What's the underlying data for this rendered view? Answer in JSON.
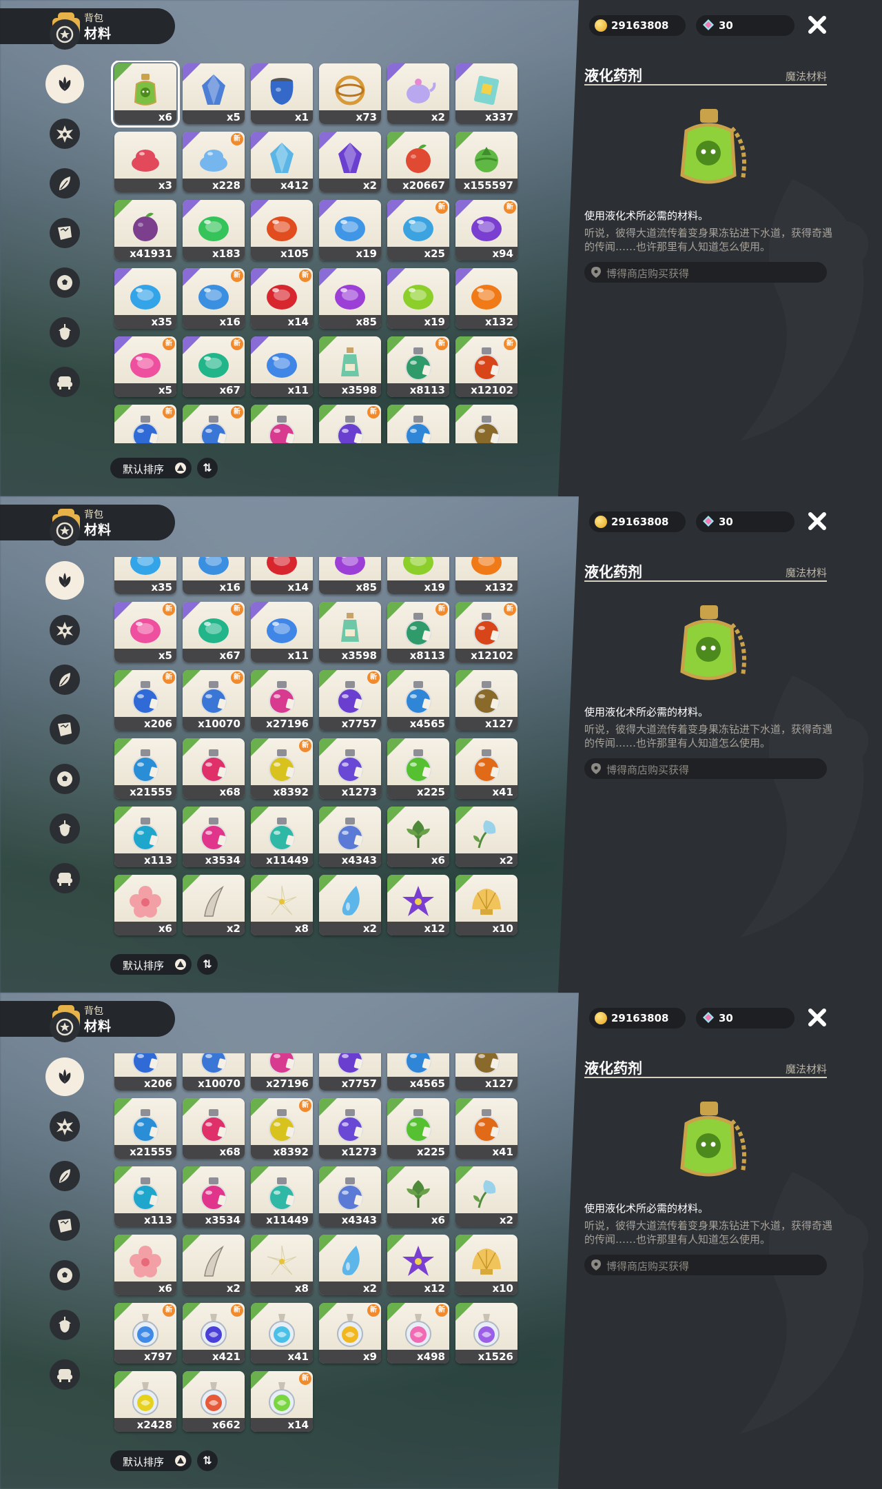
{
  "header": {
    "sub": "背包",
    "title": "材料"
  },
  "currency": {
    "coins": "29163808",
    "gems": "30"
  },
  "sort": {
    "label": "默认排序"
  },
  "detail": {
    "name": "液化药剂",
    "category": "魔法材料",
    "description": "使用液化术所必需的材料。",
    "lore": "听说，彼得大道流传着变身果冻钻进下水道，获得奇遇的传闻……也许那里有人知道怎么使用。",
    "source": "博得商店购买获得"
  },
  "categories": [
    "star-icon",
    "leaf-cluster-icon",
    "spiky-star-icon",
    "herb-icon",
    "scroll-icon",
    "soccer-ball-icon",
    "acorn-icon",
    "chair-icon"
  ],
  "items": [
    {
      "count": "x6",
      "color": "#7bc043",
      "shape": "potion",
      "q": "green",
      "selected": true
    },
    {
      "count": "x5",
      "color": "#4d7fd6",
      "shape": "gem",
      "q": "purple"
    },
    {
      "count": "x1",
      "color": "#3569c9",
      "shape": "pot",
      "q": "purple"
    },
    {
      "count": "x73",
      "color": "#d89a38",
      "shape": "ring",
      "q": "orange"
    },
    {
      "count": "x2",
      "color": "#b9a8ef",
      "shape": "teapot",
      "q": "purple"
    },
    {
      "count": "x337",
      "color": "#7fd6d0",
      "shape": "card",
      "q": "purple"
    },
    {
      "count": "x3",
      "color": "#e24a5b",
      "shape": "blob"
    },
    {
      "count": "x228",
      "color": "#76b6ef",
      "shape": "blob",
      "q": "purple",
      "new": true
    },
    {
      "count": "x412",
      "color": "#5bb6e6",
      "shape": "crystal",
      "q": "purple"
    },
    {
      "count": "x2",
      "color": "#6b3fd0",
      "shape": "crystal",
      "q": "purple"
    },
    {
      "count": "x20667",
      "color": "#e04a33",
      "shape": "fruit",
      "q": "green"
    },
    {
      "count": "x155597",
      "color": "#5fb844",
      "shape": "leafball",
      "q": "green"
    },
    {
      "count": "x41931",
      "color": "#7b3f8e",
      "shape": "fruit",
      "q": "green"
    },
    {
      "count": "x183",
      "color": "#35c45a",
      "shape": "jelly",
      "q": "purple"
    },
    {
      "count": "x105",
      "color": "#e24d1f",
      "shape": "jelly",
      "q": "purple"
    },
    {
      "count": "x19",
      "color": "#3f95e6",
      "shape": "jelly",
      "q": "purple"
    },
    {
      "count": "x25",
      "color": "#3aa3e0",
      "shape": "jelly",
      "q": "purple",
      "new": true
    },
    {
      "count": "x94",
      "color": "#7a3fd0",
      "shape": "jelly",
      "q": "purple",
      "new": true
    },
    {
      "count": "x35",
      "color": "#33a4e8",
      "shape": "jelly",
      "q": "purple"
    },
    {
      "count": "x16",
      "color": "#3a8fe0",
      "shape": "jelly",
      "q": "purple",
      "new": true
    },
    {
      "count": "x14",
      "color": "#d8262f",
      "shape": "jelly",
      "q": "purple",
      "new": true
    },
    {
      "count": "x85",
      "color": "#9c3fd6",
      "shape": "jelly",
      "q": "purple"
    },
    {
      "count": "x19",
      "color": "#8ccf2a",
      "shape": "jelly",
      "q": "purple"
    },
    {
      "count": "x132",
      "color": "#f07a18",
      "shape": "jelly",
      "q": "purple"
    },
    {
      "count": "x5",
      "color": "#ee4f9e",
      "shape": "jelly",
      "q": "purple",
      "new": true
    },
    {
      "count": "x67",
      "color": "#22b58a",
      "shape": "jelly",
      "q": "purple",
      "new": true
    },
    {
      "count": "x11",
      "color": "#3f86e6",
      "shape": "jelly",
      "q": "purple"
    },
    {
      "count": "x3598",
      "color": "#6ec7a6",
      "shape": "bottle",
      "q": "green"
    },
    {
      "count": "x8113",
      "color": "#2f9a6a",
      "shape": "flask",
      "q": "green",
      "new": true
    },
    {
      "count": "x12102",
      "color": "#d84518",
      "shape": "flask",
      "q": "green",
      "new": true
    },
    {
      "count": "x206",
      "color": "#2f6ad6",
      "shape": "flask",
      "q": "green",
      "new": true
    },
    {
      "count": "x10070",
      "color": "#3a76d6",
      "shape": "flask",
      "q": "green",
      "new": true
    },
    {
      "count": "x27196",
      "color": "#d83a8f",
      "shape": "flask",
      "q": "green"
    },
    {
      "count": "x7757",
      "color": "#6a3fd0",
      "shape": "flask",
      "q": "green",
      "new": true
    },
    {
      "count": "x4565",
      "color": "#2f86d6",
      "shape": "flask",
      "q": "green"
    },
    {
      "count": "x127",
      "color": "#8a6a2a",
      "shape": "flask",
      "q": "green"
    },
    {
      "count": "x21555",
      "color": "#2a8ed6",
      "shape": "flask",
      "q": "green"
    },
    {
      "count": "x68",
      "color": "#e0306a",
      "shape": "flask",
      "q": "green"
    },
    {
      "count": "x8392",
      "color": "#d8c21e",
      "shape": "flask",
      "q": "green",
      "new": true
    },
    {
      "count": "x1273",
      "color": "#6a48d6",
      "shape": "flask",
      "q": "green"
    },
    {
      "count": "x225",
      "color": "#55c030",
      "shape": "flask",
      "q": "green"
    },
    {
      "count": "x41",
      "color": "#e06a18",
      "shape": "flask",
      "q": "green"
    },
    {
      "count": "x113",
      "color": "#1fa6cc",
      "shape": "flask",
      "q": "green"
    },
    {
      "count": "x3534",
      "color": "#e0358a",
      "shape": "flask",
      "q": "green"
    },
    {
      "count": "x11449",
      "color": "#2fb8a6",
      "shape": "flask",
      "q": "green"
    },
    {
      "count": "x4343",
      "color": "#5a7ad6",
      "shape": "flask",
      "q": "green"
    },
    {
      "count": "x6",
      "color": "#4e8a3a",
      "shape": "bud",
      "q": "green"
    },
    {
      "count": "x2",
      "color": "#9ad2ea",
      "shape": "bellflower",
      "q": "green"
    },
    {
      "count": "x6",
      "color": "#f2a0a6",
      "shape": "flower",
      "q": "green"
    },
    {
      "count": "x2",
      "color": "#d6cfc2",
      "shape": "horn",
      "q": "green"
    },
    {
      "count": "x8",
      "color": "#f5f0d6",
      "shape": "lily",
      "q": "green"
    },
    {
      "count": "x2",
      "color": "#5cb6ea",
      "shape": "drop",
      "q": "green"
    },
    {
      "count": "x12",
      "color": "#7a3fd0",
      "shape": "star-flower",
      "q": "green"
    },
    {
      "count": "x10",
      "color": "#f0c45a",
      "shape": "shell",
      "q": "green"
    },
    {
      "count": "x797",
      "color": "#3f8ae6",
      "shape": "orb-bottle",
      "q": "green",
      "new": true
    },
    {
      "count": "x421",
      "color": "#4a3fd6",
      "shape": "orb-bottle",
      "q": "green",
      "new": true
    },
    {
      "count": "x41",
      "color": "#4ac0e6",
      "shape": "orb-bottle",
      "q": "green"
    },
    {
      "count": "x9",
      "color": "#f0b81e",
      "shape": "orb-bottle",
      "q": "green",
      "new": true
    },
    {
      "count": "x498",
      "color": "#f06ab4",
      "shape": "orb-bottle",
      "q": "green",
      "new": true
    },
    {
      "count": "x1526",
      "color": "#9a5fe6",
      "shape": "orb-bottle",
      "q": "green"
    },
    {
      "count": "x2428",
      "color": "#e6d21e",
      "shape": "orb-bottle",
      "q": "green"
    },
    {
      "count": "x662",
      "color": "#e65a3a",
      "shape": "orb-bottle",
      "q": "green"
    },
    {
      "count": "x14",
      "color": "#7ad640",
      "shape": "orb-bottle",
      "q": "green",
      "new": true
    }
  ],
  "new_badge": "新"
}
